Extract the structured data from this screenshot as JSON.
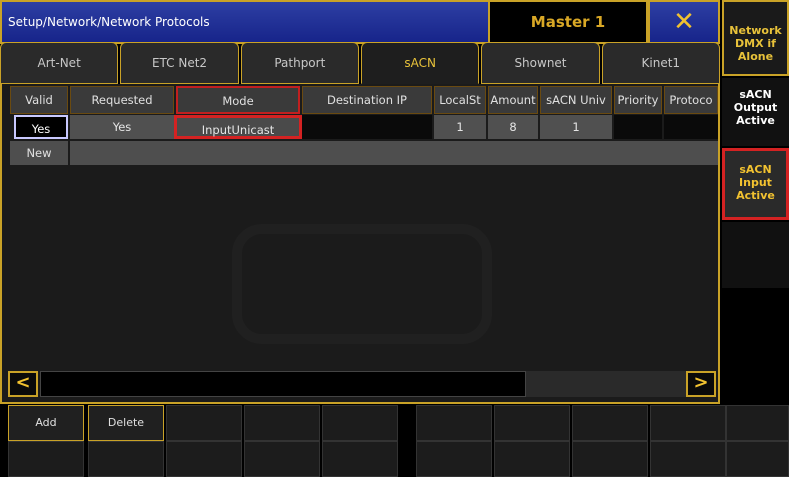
{
  "title": {
    "path": "Setup/Network/Network Protocols",
    "master": "Master 1",
    "close": "✕"
  },
  "tabs": [
    "Art-Net",
    "ETC Net2",
    "Pathport",
    "sACN",
    "Shownet",
    "Kinet1"
  ],
  "active_tab": "sACN",
  "table": {
    "headers": [
      "Valid",
      "Requested",
      "Mode",
      "Destination IP",
      "LocalSt",
      "Amount",
      "sACN Univ",
      "Priority",
      "Protoco"
    ],
    "row": {
      "valid": "Yes",
      "requested": "Yes",
      "mode": "InputUnicast",
      "destination_ip": "",
      "local_start": "1",
      "amount": "8",
      "sacn_universe": "1",
      "priority": "",
      "protocol": ""
    },
    "new_row_label": "New"
  },
  "scroll": {
    "left": "<",
    "right": ">"
  },
  "buttons": {
    "add": "Add",
    "delete": "Delete"
  },
  "side": {
    "network": "Network DMX if Alone",
    "output": "sACN Output Active",
    "input": "sACN Input Active"
  },
  "colors": {
    "accent": "#c9a227",
    "highlight": "#d42222",
    "titlebar": "#17248a"
  }
}
